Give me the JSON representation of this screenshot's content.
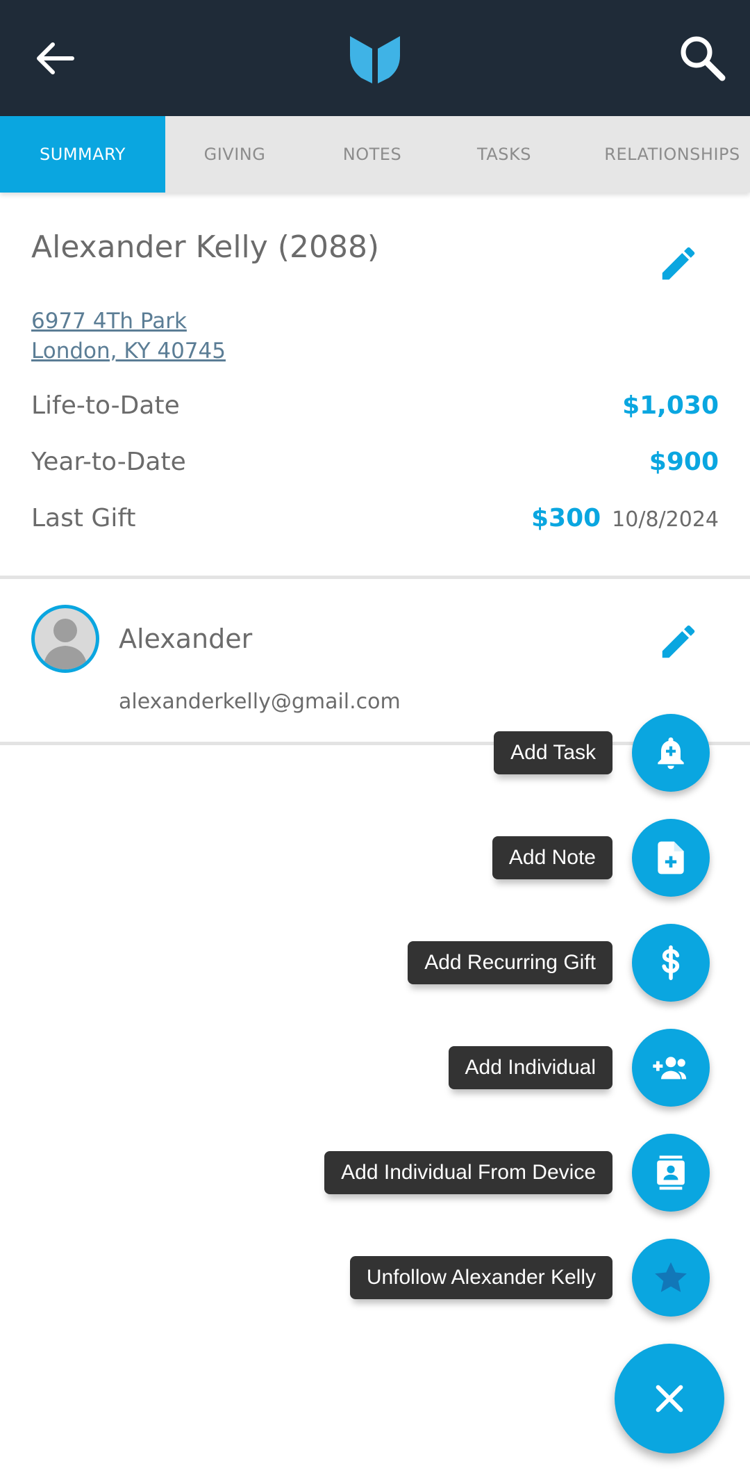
{
  "colors": {
    "header_bg": "#1f2b38",
    "accent": "#0aa6e0",
    "tab_bg": "#e6e6e6",
    "label_bg": "#333333"
  },
  "header": {
    "back_icon": "arrow-left-icon",
    "logo_icon": "app-logo-icon",
    "search_icon": "search-icon"
  },
  "tabs": [
    {
      "label": "SUMMARY",
      "active": true
    },
    {
      "label": "GIVING",
      "active": false
    },
    {
      "label": "NOTES",
      "active": false
    },
    {
      "label": "TASKS",
      "active": false
    },
    {
      "label": "RELATIONSHIPS",
      "active": false
    }
  ],
  "summary": {
    "name": "Alexander Kelly (2088)",
    "address_line1": "6977 4Th Park",
    "address_line2": "London, KY 40745",
    "life_to_date_label": "Life-to-Date",
    "life_to_date_value": "$1,030",
    "year_to_date_label": "Year-to-Date",
    "year_to_date_value": "$900",
    "last_gift_label": "Last Gift",
    "last_gift_value": "$300",
    "last_gift_date": "10/8/2024"
  },
  "contact": {
    "name": "Alexander",
    "email": "alexanderkelly@gmail.com"
  },
  "fab_menu": {
    "items": [
      {
        "label": "Add Task",
        "icon": "bell-plus-icon"
      },
      {
        "label": "Add Note",
        "icon": "note-add-icon"
      },
      {
        "label": "Add Recurring Gift",
        "icon": "dollar-icon"
      },
      {
        "label": "Add Individual",
        "icon": "group-add-icon"
      },
      {
        "label": "Add Individual From Device",
        "icon": "contact-card-icon"
      },
      {
        "label": "Unfollow Alexander Kelly",
        "icon": "star-icon"
      }
    ],
    "close_icon": "close-icon"
  }
}
